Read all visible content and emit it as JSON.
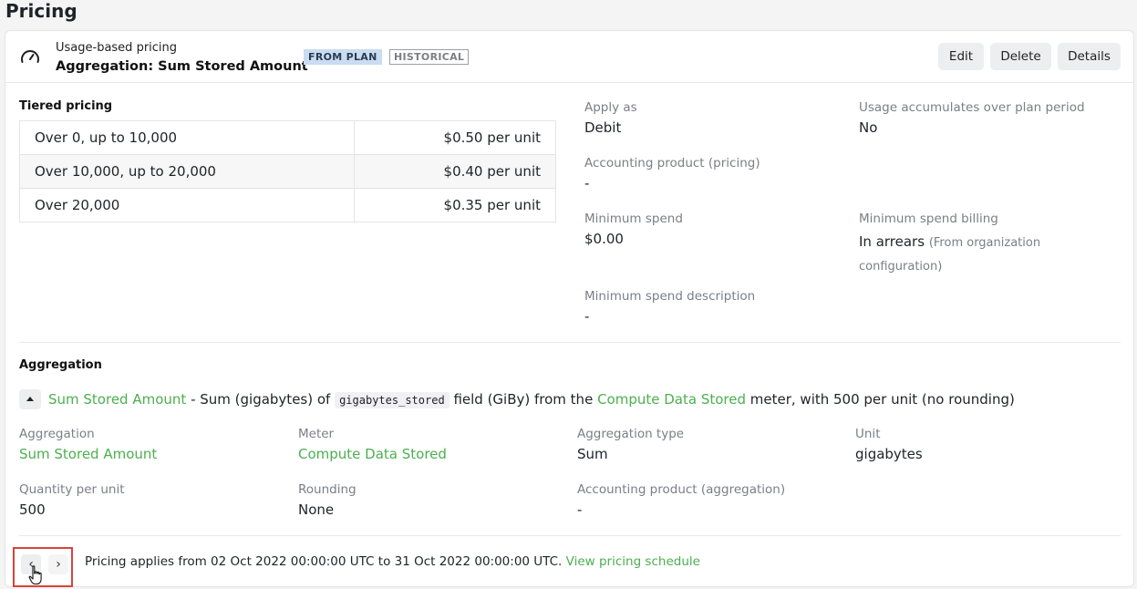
{
  "page": {
    "title": "Pricing"
  },
  "header": {
    "kind": "Usage-based pricing",
    "name": "Aggregation: Sum Stored Amount",
    "badges": {
      "plan": "FROM PLAN",
      "historical": "HISTORICAL"
    },
    "buttons": {
      "edit": "Edit",
      "delete": "Delete",
      "details": "Details"
    }
  },
  "tiered": {
    "title": "Tiered pricing",
    "rows": [
      {
        "range": "Over 0, up to 10,000",
        "price": "$0.50 per unit"
      },
      {
        "range": "Over 10,000, up to 20,000",
        "price": "$0.40 per unit"
      },
      {
        "range": "Over 20,000",
        "price": "$0.35 per unit"
      }
    ]
  },
  "details": {
    "apply_as": {
      "label": "Apply as",
      "value": "Debit"
    },
    "accumulates": {
      "label": "Usage accumulates over plan period",
      "value": "No"
    },
    "accounting_pricing": {
      "label": "Accounting product (pricing)",
      "value": "-"
    },
    "min_spend": {
      "label": "Minimum spend",
      "value": "$0.00"
    },
    "min_spend_billing": {
      "label": "Minimum spend billing",
      "value": "In arrears",
      "note": "(From organization configuration)"
    },
    "min_spend_desc": {
      "label": "Minimum spend description",
      "value": "-"
    }
  },
  "aggregation": {
    "title": "Aggregation",
    "summary": {
      "name": "Sum Stored Amount",
      "part1": " - Sum (gigabytes) of ",
      "field": "gigabytes_stored",
      "part2": " field (GiBy) from the ",
      "meter": "Compute Data Stored",
      "part3": " meter, with 500 per unit (no rounding)"
    },
    "fields": {
      "aggregation": {
        "label": "Aggregation",
        "value": "Sum Stored Amount"
      },
      "meter": {
        "label": "Meter",
        "value": "Compute Data Stored"
      },
      "type": {
        "label": "Aggregation type",
        "value": "Sum"
      },
      "unit": {
        "label": "Unit",
        "value": "gigabytes"
      },
      "qty": {
        "label": "Quantity per unit",
        "value": "500"
      },
      "rounding": {
        "label": "Rounding",
        "value": "None"
      },
      "accounting": {
        "label": "Accounting product (aggregation)",
        "value": "-"
      }
    }
  },
  "footer": {
    "prev": "‹",
    "next": "›",
    "text": "Pricing applies from 02 Oct 2022 00:00:00 UTC to 31 Oct 2022 00:00:00 UTC.",
    "link": "View pricing schedule"
  },
  "colors": {
    "link": "#4caf50",
    "highlight_border": "#d9423b",
    "badge_plan_bg": "#c9dcf0"
  },
  "icons": {
    "header": "gauge-icon",
    "collapse": "caret-up-icon",
    "cursor": "hand-pointer-icon"
  }
}
